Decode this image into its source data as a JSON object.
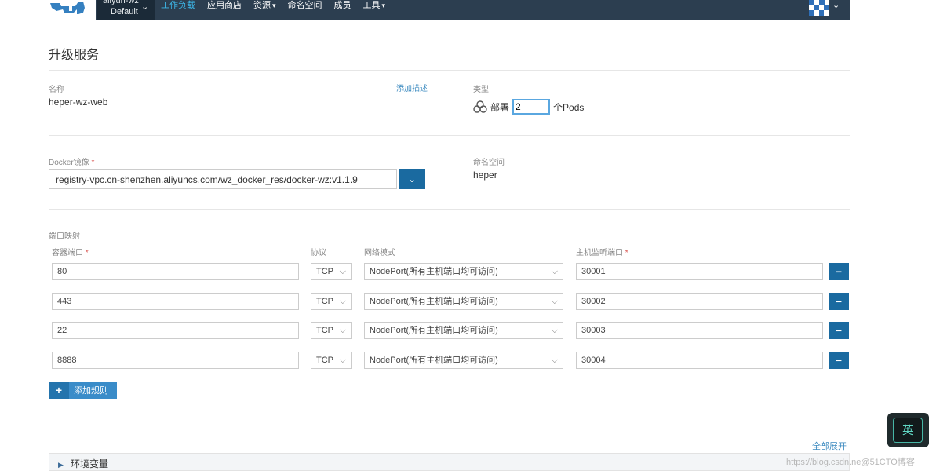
{
  "header": {
    "env_name": "aliyun-wz",
    "env_sub": "Default",
    "nav": [
      {
        "label": "工作负载",
        "active": true,
        "dropdown": false
      },
      {
        "label": "应用商店",
        "active": false,
        "dropdown": false
      },
      {
        "label": "资源",
        "active": false,
        "dropdown": true
      },
      {
        "label": "命名空间",
        "active": false,
        "dropdown": false
      },
      {
        "label": "成员",
        "active": false,
        "dropdown": false
      },
      {
        "label": "工具",
        "active": false,
        "dropdown": true
      }
    ]
  },
  "page": {
    "title": "升级服务"
  },
  "basic": {
    "name_label": "名称",
    "name_value": "heper-wz-web",
    "add_description": "添加描述",
    "type_label": "类型",
    "deploy_label": "部署",
    "deploy_count": "2",
    "pods_label": "个Pods"
  },
  "image": {
    "label": "Docker镜像",
    "required_mark": "*",
    "value": "registry-vpc.cn-shenzhen.aliyuncs.com/wz_docker_res/docker-wz:v1.1.9",
    "namespace_label": "命名空间",
    "namespace_value": "heper"
  },
  "ports": {
    "section_label": "端口映射",
    "col_container": "容器端口",
    "col_protocol": "协议",
    "col_network": "网络模式",
    "col_host": "主机监听端口",
    "required_mark": "*",
    "rows": [
      {
        "container": "80",
        "protocol": "TCP",
        "network": "NodePort(所有主机端口均可访问)",
        "host": "30001"
      },
      {
        "container": "443",
        "protocol": "TCP",
        "network": "NodePort(所有主机端口均可访问)",
        "host": "30002"
      },
      {
        "container": "22",
        "protocol": "TCP",
        "network": "NodePort(所有主机端口均可访问)",
        "host": "30003"
      },
      {
        "container": "8888",
        "protocol": "TCP",
        "network": "NodePort(所有主机端口均可访问)",
        "host": "30004"
      }
    ],
    "add_rule": "添加规则"
  },
  "expand_all": "全部展开",
  "env_vars": {
    "title": "环境变量"
  },
  "ime": {
    "label": "英"
  },
  "watermark": "https://blog.csdn.ne@51CTO博客"
}
